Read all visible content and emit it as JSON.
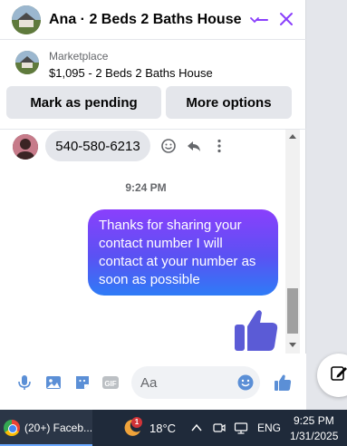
{
  "header": {
    "title": "Ana · 2 Beds 2 Baths House"
  },
  "listing": {
    "label": "Marketplace",
    "item": "$1,095 - 2 Beds 2 Baths House",
    "buttons": {
      "pending": "Mark as pending",
      "more": "More options"
    }
  },
  "messages": {
    "incoming_phone": "540-580-6213",
    "timestamp": "9:24 PM",
    "outgoing_text": "Thanks for sharing your contact number I will contact at your number as soon as possible"
  },
  "composer": {
    "placeholder": "Aa",
    "gif_label": "GIF"
  },
  "taskbar": {
    "app_label": "(20+) Faceb...",
    "weather_badge": "1",
    "temperature": "18°C",
    "language": "ENG",
    "time": "9:25 PM",
    "date": "1/31/2025"
  },
  "colors": {
    "accent": "#8a3ffc",
    "like_blue": "#5b5bd6",
    "bubble_gradient": [
      "#8a3ffc",
      "#5a52f3",
      "#2e7bf6"
    ]
  }
}
